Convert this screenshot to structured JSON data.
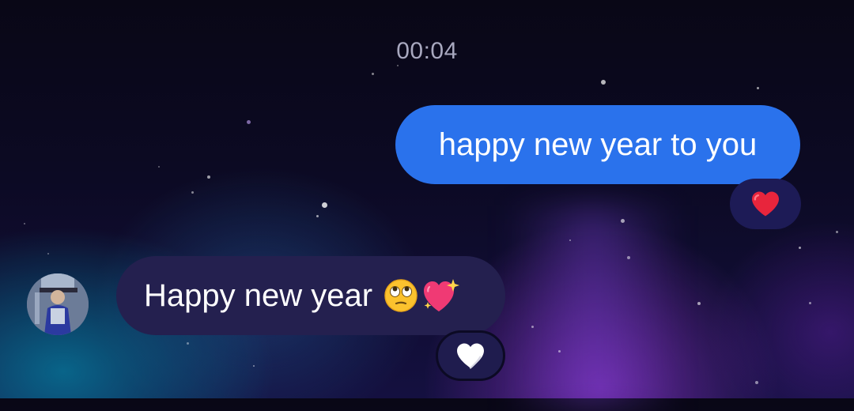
{
  "conversation": {
    "timestamp": "00:04",
    "messages": [
      {
        "direction": "outgoing",
        "text": "happy new year to you",
        "reaction": "red-heart",
        "bubble_color": "#2a72ec"
      },
      {
        "direction": "incoming",
        "text": "Happy new year",
        "emojis": [
          "face-with-rolling-eyes",
          "sparkling-heart"
        ],
        "reaction": "white-heart",
        "bubble_color": "#24204f"
      }
    ]
  },
  "colors": {
    "background": "#0c0a24",
    "timestamp_text": "#a8a8bf",
    "reaction_pill": "#1d1b56",
    "heart_red": "#e8253c",
    "heart_white": "#ffffff"
  }
}
